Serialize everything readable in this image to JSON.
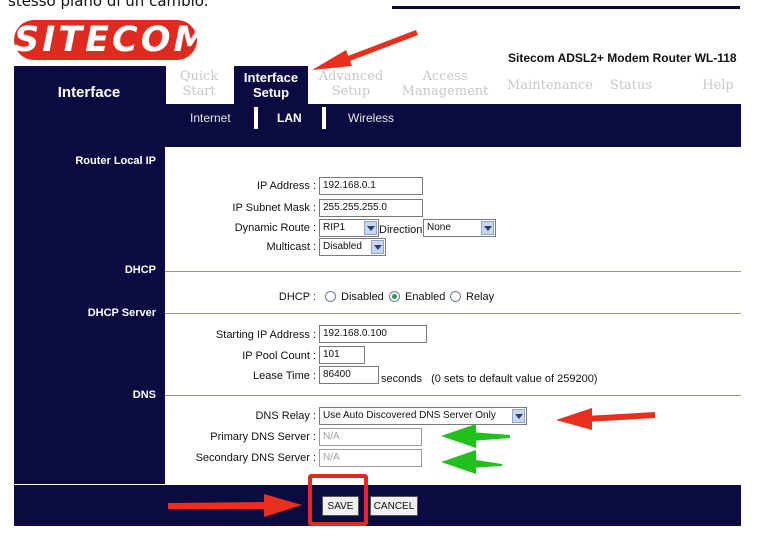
{
  "caption": "stesso piano di un cambio.",
  "brand": {
    "logo": "SITECOM",
    "model": "Sitecom ADSL2+ Modem Router WL-118"
  },
  "nav": {
    "section_label": "Interface",
    "tabs": [
      {
        "line1": "Quick",
        "line2": "Start"
      },
      {
        "line1": "Interface",
        "line2": "Setup"
      },
      {
        "line1": "Advanced",
        "line2": "Setup"
      },
      {
        "line1": "Access",
        "line2": "Management"
      },
      {
        "line1": "Maintenance",
        "line2": ""
      },
      {
        "line1": "Status",
        "line2": ""
      },
      {
        "line1": "Help",
        "line2": ""
      }
    ],
    "subtabs": [
      "Internet",
      "LAN",
      "Wireless"
    ]
  },
  "sections": {
    "router_local_ip": "Router Local IP",
    "dhcp": "DHCP",
    "dhcp_server": "DHCP Server",
    "dns": "DNS"
  },
  "form": {
    "ip_address": {
      "label": "IP Address :",
      "value": "192.168.0.1"
    },
    "subnet_mask": {
      "label": "IP Subnet Mask :",
      "value": "255.255.255.0"
    },
    "dynamic_route": {
      "label": "Dynamic Route :",
      "value": "RIP1",
      "direction_label": "Direction",
      "direction_value": "None"
    },
    "multicast": {
      "label": "Multicast :",
      "value": "Disabled"
    },
    "dhcp": {
      "label": "DHCP :",
      "options": [
        "Disabled",
        "Enabled",
        "Relay"
      ],
      "selected": "Enabled"
    },
    "starting_ip": {
      "label": "Starting IP Address :",
      "value": "192.168.0.100"
    },
    "pool_count": {
      "label": "IP Pool Count :",
      "value": "101"
    },
    "lease_time": {
      "label": "Lease Time :",
      "value": "86400",
      "suffix": "seconds   (0 sets to default value of 259200)"
    },
    "dns_relay": {
      "label": "DNS Relay :",
      "value": "Use Auto Discovered DNS Server Only"
    },
    "primary_dns": {
      "label": "Primary DNS Server :",
      "value": "N/A"
    },
    "secondary_dns": {
      "label": "Secondary DNS Server :",
      "value": "N/A"
    }
  },
  "buttons": {
    "save": "SAVE",
    "cancel": "CANCEL"
  },
  "colors": {
    "navy": "#0b0b42",
    "brand_red": "#e02a1f",
    "annotation_red": "#e8301c",
    "annotation_green": "#22c01e"
  }
}
